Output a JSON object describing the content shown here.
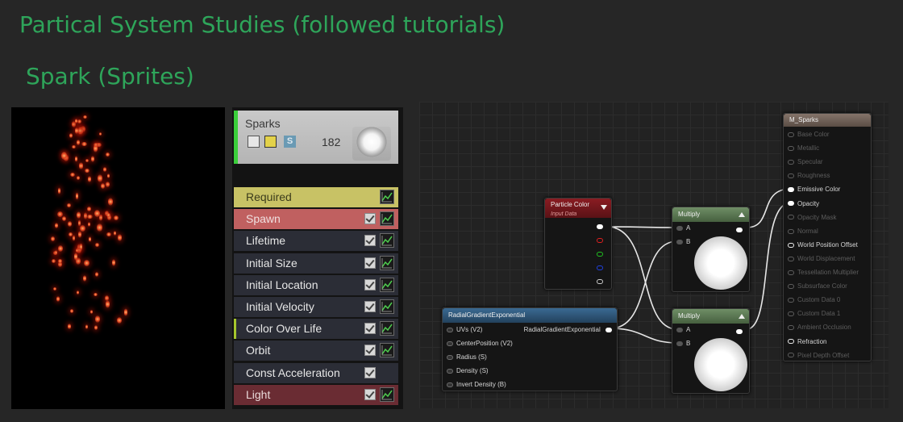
{
  "page": {
    "title": "Partical System Studies (followed tutorials)",
    "subtitle": "Spark (Sprites)"
  },
  "emitter": {
    "name": "Sparks",
    "particle_count": "182",
    "solo_badge": "S",
    "modules": [
      {
        "label": "Required",
        "bg": "#c8c265",
        "text": "#3c3c1c",
        "checkbox": false,
        "graph": true
      },
      {
        "label": "Spawn",
        "bg": "#c06060",
        "text": "#f0e0e0",
        "checkbox": true,
        "graph": true
      },
      {
        "label": "Lifetime",
        "bg": "#2b2d36",
        "text": "#e6e6e6",
        "checkbox": true,
        "graph": true
      },
      {
        "label": "Initial Size",
        "bg": "#2b2d36",
        "text": "#e6e6e6",
        "checkbox": true,
        "graph": true
      },
      {
        "label": "Initial Location",
        "bg": "#2b2d36",
        "text": "#e6e6e6",
        "checkbox": true,
        "graph": true
      },
      {
        "label": "Initial Velocity",
        "bg": "#2b2d36",
        "text": "#e6e6e6",
        "checkbox": true,
        "graph": true
      },
      {
        "label": "Color Over Life",
        "bg": "#2b2d36",
        "text": "#e6e6e6",
        "checkbox": true,
        "graph": true,
        "accent": "#a6c72c"
      },
      {
        "label": "Orbit",
        "bg": "#2b2d36",
        "text": "#e6e6e6",
        "checkbox": true,
        "graph": true
      },
      {
        "label": "Const Acceleration",
        "bg": "#2b2d36",
        "text": "#e6e6e6",
        "checkbox": true,
        "graph": false
      },
      {
        "label": "Light",
        "bg": "#6a2c33",
        "text": "#eadada",
        "checkbox": true,
        "graph": true
      }
    ]
  },
  "material": {
    "particle_color": {
      "title": "Particle Color",
      "subtitle": "Input Data",
      "pin_colors": [
        "#ffffff",
        "#e02020",
        "#20c020",
        "#2040e0",
        "#cccccc"
      ]
    },
    "radial_gradient": {
      "title": "RadialGradientExponential",
      "inputs": [
        "UVs (V2)",
        "CenterPosition (V2)",
        "Radius (S)",
        "Density (S)",
        "Invert Density (B)"
      ],
      "output": "RadialGradientExponential"
    },
    "multiply_nodes": [
      {
        "title": "Multiply",
        "inputs": [
          "A",
          "B"
        ]
      },
      {
        "title": "Multiply",
        "inputs": [
          "A",
          "B"
        ]
      }
    ],
    "result": {
      "title": "M_Sparks",
      "pins": [
        {
          "label": "Base Color",
          "active": false
        },
        {
          "label": "Metallic",
          "active": false
        },
        {
          "label": "Specular",
          "active": false
        },
        {
          "label": "Roughness",
          "active": false
        },
        {
          "label": "Emissive Color",
          "active": true,
          "connected": true
        },
        {
          "label": "Opacity",
          "active": true,
          "connected": true
        },
        {
          "label": "Opacity Mask",
          "active": false
        },
        {
          "label": "Normal",
          "active": false
        },
        {
          "label": "World Position Offset",
          "active": true,
          "connected": false
        },
        {
          "label": "World Displacement",
          "active": false
        },
        {
          "label": "Tessellation Multiplier",
          "active": false
        },
        {
          "label": "Subsurface Color",
          "active": false
        },
        {
          "label": "Custom Data 0",
          "active": false
        },
        {
          "label": "Custom Data 1",
          "active": false
        },
        {
          "label": "Ambient Occlusion",
          "active": false
        },
        {
          "label": "Refraction",
          "active": true,
          "connected": false
        },
        {
          "label": "Pixel Depth Offset",
          "active": false
        }
      ]
    }
  },
  "colors": {
    "title_green": "#2ea55a",
    "particle_color_header": "#8a1c22",
    "radial_header": "#2c4f70",
    "multiply_header": "#5d7a55",
    "result_header": "#6d5d52"
  }
}
